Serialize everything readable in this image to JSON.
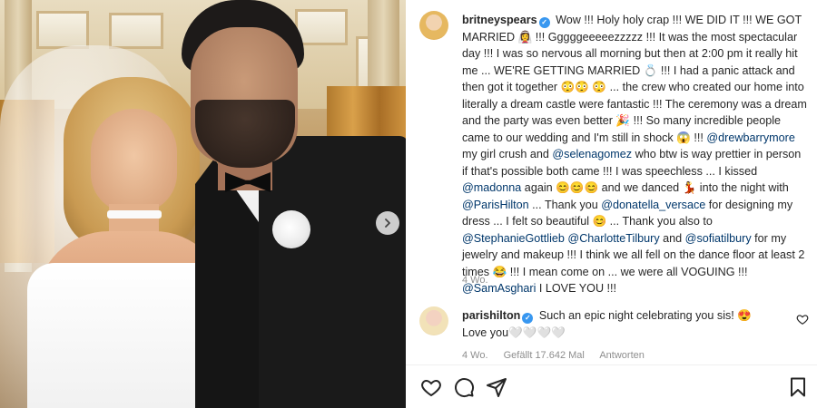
{
  "post": {
    "image_alt_icon": "chevron-right-icon"
  },
  "caption": {
    "username": "britneyspears",
    "segments": [
      {
        "t": "Wow !!! Holy holy crap !!! WE DID IT !!! WE GOT MARRIED ",
        "m": false
      },
      {
        "t": "👰‍♀️",
        "m": false
      },
      {
        "t": " !!! Gggggeeeeezzzzz !!! It was the most spectacular day !!! I was so nervous all morning but then at 2:00 pm it really hit me ... WE'RE GETTING MARRIED ",
        "m": false
      },
      {
        "t": "💍",
        "m": false
      },
      {
        "t": " !!! I had a panic attack and then got it together ",
        "m": false
      },
      {
        "t": "😳😳 😳",
        "m": false
      },
      {
        "t": "  ... the crew who created our home into literally a dream castle were fantastic !!! The ceremony was a dream and the party was even better ",
        "m": false
      },
      {
        "t": "🎉",
        "m": false
      },
      {
        "t": " !!! So many incredible people came to our wedding and I'm still in shock ",
        "m": false
      },
      {
        "t": "😱",
        "m": false
      },
      {
        "t": " !!! ",
        "m": false
      },
      {
        "t": "@drewbarrymore",
        "m": true
      },
      {
        "t": " my girl crush and ",
        "m": false
      },
      {
        "t": "@selenagomez",
        "m": true
      },
      {
        "t": " who btw is way prettier in person if that's possible both came !!! I was speechless ... I kissed ",
        "m": false
      },
      {
        "t": "@madonna",
        "m": true
      },
      {
        "t": " again ",
        "m": false
      },
      {
        "t": "😊😊😊",
        "m": false
      },
      {
        "t": " and we danced ",
        "m": false
      },
      {
        "t": "💃",
        "m": false
      },
      {
        "t": " into the night with ",
        "m": false
      },
      {
        "t": "@ParisHilton",
        "m": true
      },
      {
        "t": " ... Thank you ",
        "m": false
      },
      {
        "t": "@donatella_versace",
        "m": true
      },
      {
        "t": " for designing my dress ... I felt so beautiful ",
        "m": false
      },
      {
        "t": "😊",
        "m": false
      },
      {
        "t": " ... Thank you also to ",
        "m": false
      },
      {
        "t": "@StephanieGottlieb",
        "m": true
      },
      {
        "t": " ",
        "m": false
      },
      {
        "t": "@CharlotteTilbury",
        "m": true
      },
      {
        "t": " and ",
        "m": false
      },
      {
        "t": "@sofiatilbury",
        "m": true
      },
      {
        "t": " for my jewelry and makeup !!! I think we all fell on the dance floor at least 2 times ",
        "m": false
      },
      {
        "t": "😂",
        "m": false
      },
      {
        "t": " !!! I mean come on ... we were all VOGUING !!! ",
        "m": false
      },
      {
        "t": "@SamAsghari",
        "m": true
      },
      {
        "t": " I LOVE YOU !!!",
        "m": false
      }
    ],
    "age": "4 Wo."
  },
  "comment": {
    "username": "parishilton",
    "text_before": " Such an epic night celebrating you sis! ",
    "emoji": "😍",
    "text_after": " Love you🤍🤍🤍🤍",
    "age": "4 Wo.",
    "likes": "Gefällt 17.642 Mal",
    "reply": "Antworten"
  },
  "colors": {
    "mention": "#00376b",
    "verified": "#3897f0",
    "meta": "#8e8e8e"
  },
  "icons": [
    "heart-icon",
    "comment-icon",
    "share-icon",
    "bookmark-icon",
    "verified-badge-icon",
    "chevron-right-icon"
  ]
}
